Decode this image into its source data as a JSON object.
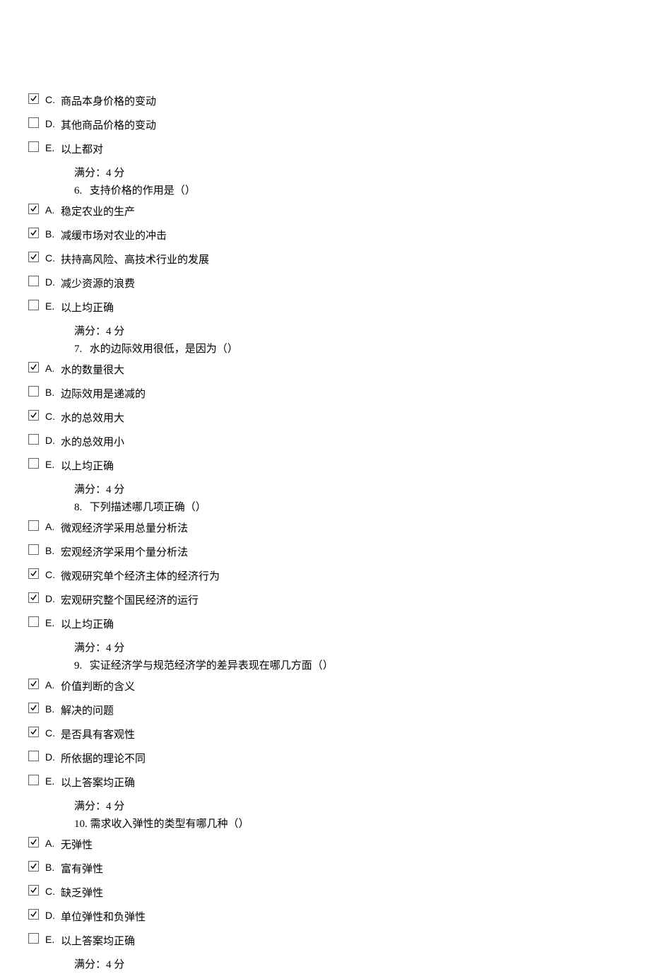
{
  "score_label": "满分：4  分",
  "questions": [
    {
      "num": "",
      "text": "",
      "options": [
        {
          "letter": "C.",
          "text": "商品本身价格的变动",
          "checked": true
        },
        {
          "letter": "D.",
          "text": "其他商品价格的变动",
          "checked": false
        },
        {
          "letter": "E.",
          "text": "以上都对",
          "checked": false
        }
      ]
    },
    {
      "num": "6.",
      "text": "支持价格的作用是（）",
      "options": [
        {
          "letter": "A.",
          "text": "稳定农业的生产",
          "checked": true
        },
        {
          "letter": "B.",
          "text": "减缓市场对农业的冲击",
          "checked": true
        },
        {
          "letter": "C.",
          "text": "扶持高风险、高技术行业的发展",
          "checked": true
        },
        {
          "letter": "D.",
          "text": "减少资源的浪费",
          "checked": false
        },
        {
          "letter": "E.",
          "text": "以上均正确",
          "checked": false
        }
      ]
    },
    {
      "num": "7.",
      "text": "水的边际效用很低，是因为（）",
      "options": [
        {
          "letter": "A.",
          "text": "水的数量很大",
          "checked": true
        },
        {
          "letter": "B.",
          "text": "边际效用是递减的",
          "checked": false
        },
        {
          "letter": "C.",
          "text": "水的总效用大",
          "checked": true
        },
        {
          "letter": "D.",
          "text": "水的总效用小",
          "checked": false
        },
        {
          "letter": "E.",
          "text": "以上均正确",
          "checked": false
        }
      ]
    },
    {
      "num": "8.",
      "text": "下列描述哪几项正确（）",
      "options": [
        {
          "letter": "A.",
          "text": "微观经济学采用总量分析法",
          "checked": false
        },
        {
          "letter": "B.",
          "text": "宏观经济学采用个量分析法",
          "checked": false
        },
        {
          "letter": "C.",
          "text": "微观研究单个经济主体的经济行为",
          "checked": true
        },
        {
          "letter": "D.",
          "text": "宏观研究整个国民经济的运行",
          "checked": true
        },
        {
          "letter": "E.",
          "text": "以上均正确",
          "checked": false
        }
      ]
    },
    {
      "num": "9.",
      "text": "实证经济学与规范经济学的差异表现在哪几方面（）",
      "options": [
        {
          "letter": "A.",
          "text": "价值判断的含义",
          "checked": true
        },
        {
          "letter": "B.",
          "text": "解决的问题",
          "checked": true
        },
        {
          "letter": "C.",
          "text": "是否具有客观性",
          "checked": true
        },
        {
          "letter": "D.",
          "text": "所依据的理论不同",
          "checked": false
        },
        {
          "letter": "E.",
          "text": "以上答案均正确",
          "checked": false
        }
      ]
    },
    {
      "num": "10.",
      "text": "需求收入弹性的类型有哪几种（）",
      "options": [
        {
          "letter": "A.",
          "text": "无弹性",
          "checked": true
        },
        {
          "letter": "B.",
          "text": "富有弹性",
          "checked": true
        },
        {
          "letter": "C.",
          "text": "缺乏弹性",
          "checked": true
        },
        {
          "letter": "D.",
          "text": "单位弹性和负弹性",
          "checked": true
        },
        {
          "letter": "E.",
          "text": "以上答案均正确",
          "checked": false
        }
      ]
    }
  ]
}
